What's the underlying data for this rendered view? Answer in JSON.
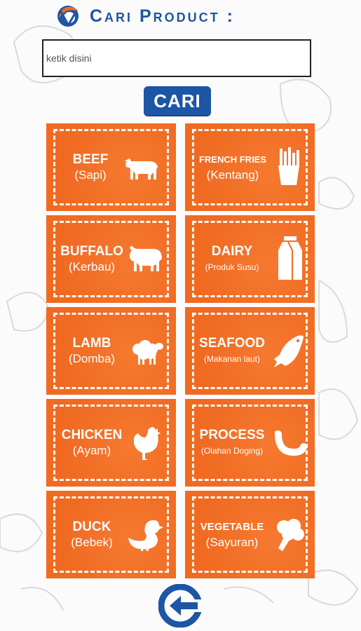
{
  "header": {
    "title": "Cari Product :",
    "logo_icon": "fork-spoon-logo-icon"
  },
  "search": {
    "placeholder": "ketik disini",
    "value": "",
    "button_label": "CARI"
  },
  "categories": [
    {
      "name": "BEEF",
      "sub": "(Sapi)",
      "icon": "cow-icon"
    },
    {
      "name": "FRENCH FRIES",
      "sub": "(Kentang)",
      "icon": "fries-icon"
    },
    {
      "name": "BUFFALO",
      "sub": "(Kerbau)",
      "icon": "buffalo-icon"
    },
    {
      "name": "DAIRY",
      "sub": "(Produk Susu)",
      "icon": "milk-carton-icon"
    },
    {
      "name": "LAMB",
      "sub": "(Domba)",
      "icon": "sheep-icon"
    },
    {
      "name": "SEAFOOD",
      "sub": "(Makanan laut)",
      "icon": "fish-icon"
    },
    {
      "name": "CHICKEN",
      "sub": "(Ayam)",
      "icon": "chicken-icon"
    },
    {
      "name": "PROCESS",
      "sub": "(Olahan Doging)",
      "icon": "sausage-icon"
    },
    {
      "name": "DUCK",
      "sub": "(Bebek)",
      "icon": "duck-icon"
    },
    {
      "name": "VEGETABLE",
      "sub": "(Sayuran)",
      "icon": "broccoli-icon"
    }
  ],
  "footer": {
    "back_icon": "back-arrow-icon"
  },
  "colors": {
    "brand_blue": "#1c56a5",
    "tile_orange": "#f06a22"
  }
}
